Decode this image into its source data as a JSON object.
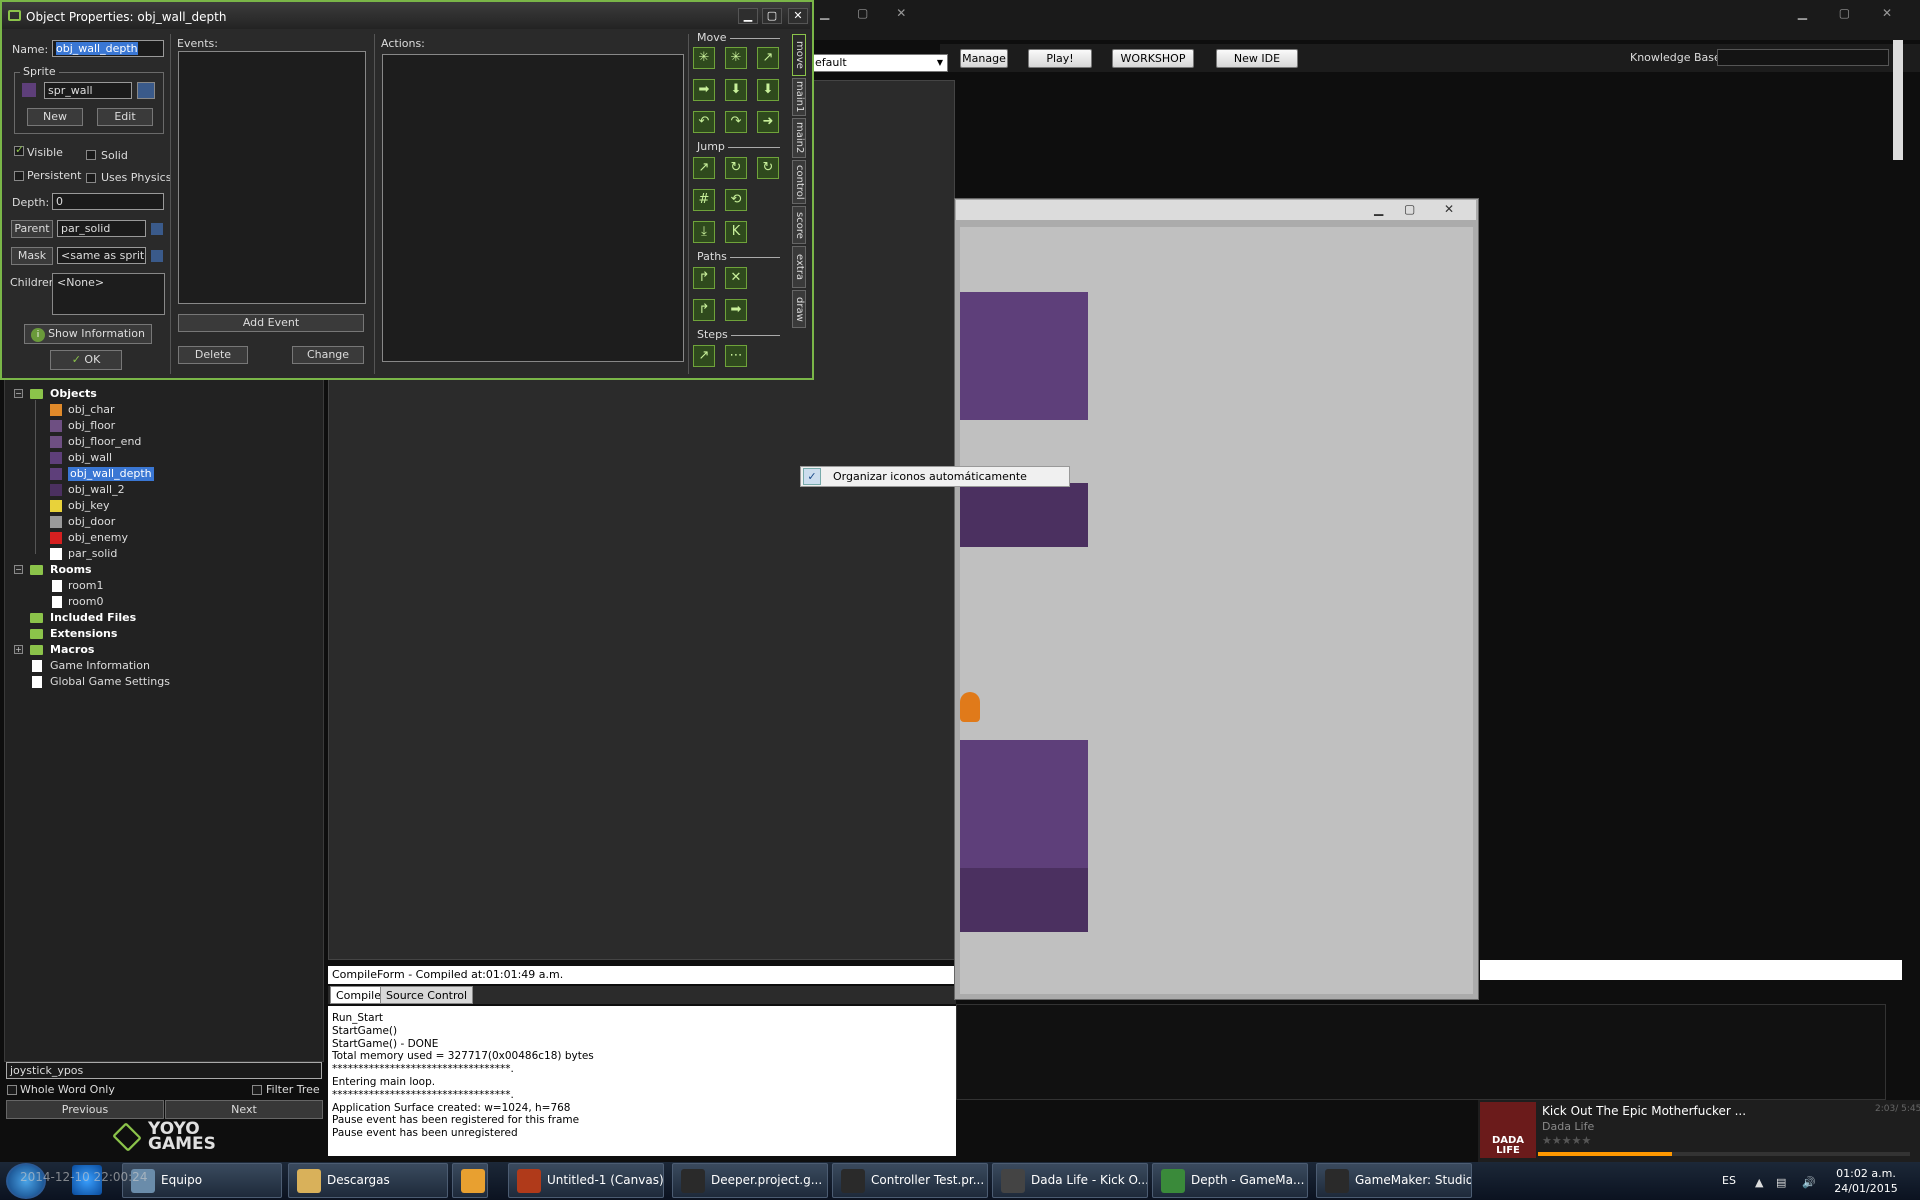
{
  "dialog": {
    "title": "Object Properties: obj_wall_depth",
    "name_label": "Name:",
    "name_value": "obj_wall_depth",
    "sprite_group": "Sprite",
    "sprite_value": "spr_wall",
    "new_button": "New",
    "edit_button": "Edit",
    "visible_label": "Visible",
    "visible_checked": true,
    "solid_label": "Solid",
    "persistent_label": "Persistent",
    "uses_physics_label": "Uses Physics",
    "depth_label": "Depth:",
    "depth_value": "0",
    "parent_button": "Parent",
    "parent_value": "par_solid",
    "mask_button": "Mask",
    "mask_value": "<same as sprite>",
    "children_label": "Children:",
    "children_value": "<None>",
    "show_information_button": "Show Information",
    "ok_button": "OK",
    "events_label": "Events:",
    "add_event_button": "Add Event",
    "delete_button": "Delete",
    "change_button": "Change",
    "actions_label": "Actions:",
    "sections": {
      "move": "Move",
      "jump": "Jump",
      "paths": "Paths",
      "steps": "Steps"
    },
    "tabs": [
      "move",
      "main1",
      "main2",
      "control",
      "score",
      "extra",
      "draw"
    ],
    "active_tab": "move"
  },
  "toolbar": {
    "combo_value": "efault",
    "manage": "Manage",
    "play": "Play!",
    "workshop": "WORKSHOP",
    "new_ide": "New IDE",
    "knowledge_base": "Knowledge Base:"
  },
  "tree": {
    "partial_top": "...",
    "objects_label": "Objects",
    "objects": [
      {
        "name": "obj_char",
        "color": "#e08a2a"
      },
      {
        "name": "obj_floor",
        "color": "#6e4f82"
      },
      {
        "name": "obj_floor_end",
        "color": "#6e4f82"
      },
      {
        "name": "obj_wall",
        "color": "#5e3f7a"
      },
      {
        "name": "obj_wall_depth",
        "color": "#5e3f7a",
        "selected": true
      },
      {
        "name": "obj_wall_2",
        "color": "#4b3060"
      },
      {
        "name": "obj_key",
        "color": "#e8d23a"
      },
      {
        "name": "obj_door",
        "color": "#9a9a9a"
      },
      {
        "name": "obj_enemy",
        "color": "#d62020"
      },
      {
        "name": "par_solid",
        "color": "#ffffff"
      }
    ],
    "rooms_label": "Rooms",
    "rooms": [
      "room1",
      "room0"
    ],
    "included_files": "Included Files",
    "extensions": "Extensions",
    "macros": "Macros",
    "game_information": "Game Information",
    "global_game_settings": "Global Game Settings"
  },
  "search": {
    "value": "joystick_ypos",
    "whole_word": "Whole Word Only",
    "filter_tree": "Filter Tree",
    "previous": "Previous",
    "next": "Next"
  },
  "brand": {
    "yoyo": "YOYO",
    "games": "GAMES"
  },
  "compile": {
    "header": "CompileForm - Compiled at:01:01:49 a.m.",
    "tab_compile": "Compile",
    "tab_source": "Source Control",
    "log": [
      "Run_Start",
      "StartGame()",
      "StartGame() - DONE",
      "Total memory used = 327717(0x00486c18) bytes",
      "**********************************.",
      "Entering main loop.",
      "**********************************.",
      "Application Surface created: w=1024, h=768",
      "Pause event has been registered for this frame",
      "Pause event has been unregistered"
    ]
  },
  "context_menu": {
    "item": "Organizar iconos automáticamente",
    "checked": true
  },
  "now_playing": {
    "title": "Kick Out The Epic Motherfucker ...",
    "artist": "Dada Life",
    "time": "2:03/ 5:45",
    "progress": 0.36,
    "art_text": "DADA LIFE"
  },
  "taskbar": {
    "items": [
      {
        "label": "Equipo",
        "color": "#6a8caa"
      },
      {
        "label": "Descargas",
        "color": "#d9b15a"
      },
      {
        "label": "",
        "color": "#e8a030"
      },
      {
        "label": "Untitled-1 (Canvas)",
        "color": "#b03a1a"
      },
      {
        "label": "Deeper.project.g...",
        "color": "#2a2a2a"
      },
      {
        "label": "Controller Test.pr...",
        "color": "#2a2a2a"
      },
      {
        "label": "Dada Life - Kick O...",
        "color": "#444"
      },
      {
        "label": "Depth - GameMa...",
        "color": "#3a8a3a"
      },
      {
        "label": "GameMaker: Studio",
        "color": "#2a2a2a"
      }
    ],
    "overlay_text": "2014-12-10 22:00:24",
    "lang": "ES",
    "time": "01:02 a.m.",
    "date": "24/01/2015"
  }
}
